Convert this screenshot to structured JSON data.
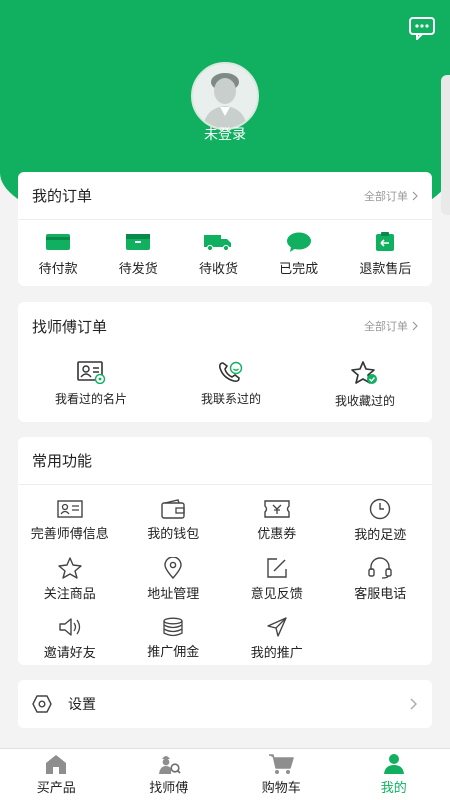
{
  "header": {
    "login_text": "未登录"
  },
  "orders": {
    "title": "我的订单",
    "all_link": "全部订单",
    "items": [
      {
        "label": "待付款",
        "icon": "wallet-icon"
      },
      {
        "label": "待发货",
        "icon": "package-icon"
      },
      {
        "label": "待收货",
        "icon": "truck-icon"
      },
      {
        "label": "已完成",
        "icon": "chat-bubble-icon"
      },
      {
        "label": "退款售后",
        "icon": "refund-icon"
      }
    ]
  },
  "master_orders": {
    "title": "找师傅订单",
    "all_link": "全部订单",
    "items": [
      {
        "label": "我看过的名片",
        "icon": "card-view-icon"
      },
      {
        "label": "我联系过的",
        "icon": "phone-contact-icon"
      },
      {
        "label": "我收藏过的",
        "icon": "star-check-icon"
      }
    ]
  },
  "functions": {
    "title": "常用功能",
    "items": [
      {
        "label": "完善师傅信息",
        "icon": "id-card-icon"
      },
      {
        "label": "我的钱包",
        "icon": "wallet-outline-icon"
      },
      {
        "label": "优惠券",
        "icon": "coupon-icon"
      },
      {
        "label": "我的足迹",
        "icon": "clock-icon"
      },
      {
        "label": "关注商品",
        "icon": "star-icon"
      },
      {
        "label": "地址管理",
        "icon": "location-icon"
      },
      {
        "label": "意见反馈",
        "icon": "edit-icon"
      },
      {
        "label": "客服电话",
        "icon": "headset-icon"
      },
      {
        "label": "邀请好友",
        "icon": "speaker-icon"
      },
      {
        "label": "推广佣金",
        "icon": "coins-icon"
      },
      {
        "label": "我的推广",
        "icon": "send-icon"
      }
    ]
  },
  "settings": {
    "label": "设置"
  },
  "tabbar": {
    "tabs": [
      {
        "label": "买产品",
        "icon": "home-icon",
        "active": false
      },
      {
        "label": "找师傅",
        "icon": "worker-search-icon",
        "active": false
      },
      {
        "label": "购物车",
        "icon": "cart-icon",
        "active": false
      },
      {
        "label": "我的",
        "icon": "person-icon",
        "active": true
      }
    ]
  },
  "colors": {
    "brand": "#10b060",
    "text": "#222222",
    "muted": "#999999",
    "background": "#f3f3f3"
  }
}
